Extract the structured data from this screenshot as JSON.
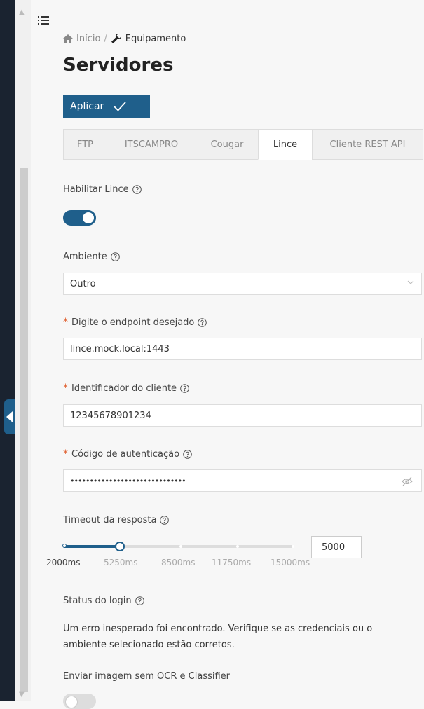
{
  "breadcrumb": {
    "home": "Início",
    "separator": "/",
    "current": "Equipamento"
  },
  "page": {
    "title": "Servidores"
  },
  "toolbar": {
    "apply_label": "Aplicar"
  },
  "tabs": [
    {
      "label": "FTP",
      "active": false
    },
    {
      "label": "ITSCAMPRO",
      "active": false
    },
    {
      "label": "Cougar",
      "active": false
    },
    {
      "label": "Lince",
      "active": true
    },
    {
      "label": "Cliente REST API",
      "active": false
    }
  ],
  "form": {
    "enable": {
      "label": "Habilitar Lince",
      "value": true
    },
    "environment": {
      "label": "Ambiente",
      "value": "Outro"
    },
    "endpoint": {
      "label": "Digite o endpoint desejado",
      "value": "lince.mock.local:1443",
      "required": true
    },
    "client_id": {
      "label": "Identificador do cliente",
      "value": "12345678901234",
      "required": true
    },
    "auth_code": {
      "label": "Código de autenticação",
      "value": "••••••••••••••••••••••••••••••",
      "required": true
    },
    "timeout": {
      "label": "Timeout da resposta",
      "value": "5000",
      "min": 2000,
      "max": 15000,
      "ticks": [
        "2000ms",
        "5250ms",
        "8500ms",
        "11750ms",
        "15000ms"
      ]
    },
    "login_status": {
      "label": "Status do login",
      "message": "Um erro inesperado foi encontrado. Verifique se as credenciais ou o ambiente selecionado estão corretos."
    },
    "send_without_ocr": {
      "label": "Enviar imagem sem OCR e Classifier",
      "value": false
    }
  },
  "icons": {
    "menu": "menu-icon",
    "home": "home-icon",
    "wrench": "wrench-icon",
    "check": "check-icon",
    "help": "help-circle-icon",
    "chevron": "chevron-down-icon",
    "eye": "eye-off-icon"
  },
  "colors": {
    "primary": "#1f5f8b",
    "sidebar": "#1a2330",
    "required": "#e06030"
  }
}
